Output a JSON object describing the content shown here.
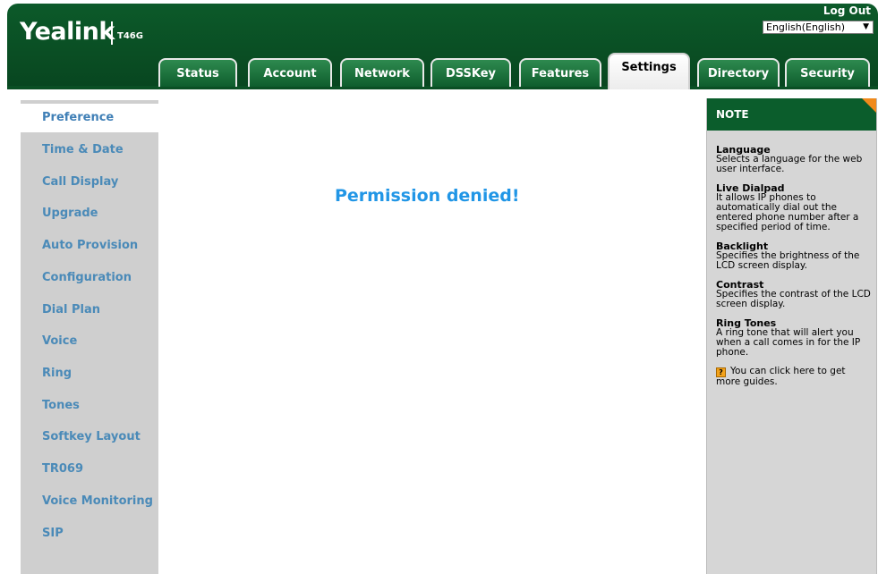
{
  "header": {
    "logo_text": "Yealink",
    "model": "T46G",
    "logout_label": "Log Out",
    "language_selected": "English(English)"
  },
  "tabs": [
    {
      "label": "Status"
    },
    {
      "label": "Account"
    },
    {
      "label": "Network"
    },
    {
      "label": "DSSKey"
    },
    {
      "label": "Features"
    },
    {
      "label": "Settings",
      "active": true
    },
    {
      "label": "Directory"
    },
    {
      "label": "Security"
    }
  ],
  "sidebar": {
    "items": [
      {
        "label": "Preference",
        "active": true
      },
      {
        "label": "Time & Date"
      },
      {
        "label": "Call Display"
      },
      {
        "label": "Upgrade"
      },
      {
        "label": "Auto Provision"
      },
      {
        "label": "Configuration"
      },
      {
        "label": "Dial Plan"
      },
      {
        "label": "Voice"
      },
      {
        "label": "Ring"
      },
      {
        "label": "Tones"
      },
      {
        "label": "Softkey Layout"
      },
      {
        "label": "TR069"
      },
      {
        "label": "Voice Monitoring"
      },
      {
        "label": "SIP"
      }
    ]
  },
  "main": {
    "message": "Permission denied!"
  },
  "note": {
    "header": "NOTE",
    "sections": [
      {
        "title": "Language",
        "text": "Selects a language for the web user interface."
      },
      {
        "title": "Live Dialpad",
        "text": "It allows IP phones to automatically dial out the entered phone number after a specified period of time."
      },
      {
        "title": "Backlight",
        "text": "Specifies the brightness of the LCD screen display."
      },
      {
        "title": "Contrast",
        "text": "Specifies the contrast of the LCD screen display."
      },
      {
        "title": "Ring Tones",
        "text": "A ring tone that will alert you when a call comes in for the IP phone."
      }
    ],
    "guide_text": "You can click here to get more guides."
  },
  "colors": {
    "header_green": "#0a4f24",
    "sidebar_link": "#4a8ab8",
    "permission_blue": "#2196e6",
    "note_corner": "#f08a1c"
  }
}
